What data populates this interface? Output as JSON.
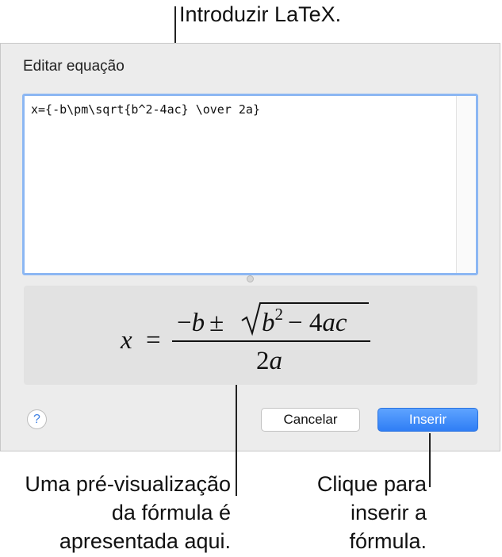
{
  "callouts": {
    "latex": "Introduzir LaTeX.",
    "preview": [
      "Uma pré-visualização",
      "da fórmula é",
      "apresentada aqui."
    ],
    "insert": [
      "Clique para",
      "inserir a",
      "fórmula."
    ]
  },
  "dialog": {
    "title": "Editar equação",
    "editor_value": "x={-b\\pm\\sqrt{b^2-4ac} \\over 2a}",
    "preview": {
      "lhs": "x",
      "equals": "=",
      "numerator": "−b ± √b² − 4ac",
      "denominator": "2a"
    },
    "help_label": "?",
    "cancel_label": "Cancelar",
    "insert_label": "Inserir"
  },
  "colors": {
    "accent": "#2f7ef5",
    "focus_ring": "#8cb7f3",
    "dialog_bg": "#ececec",
    "preview_bg": "#e2e2e2"
  },
  "icons": {
    "help": "question-mark-icon"
  }
}
